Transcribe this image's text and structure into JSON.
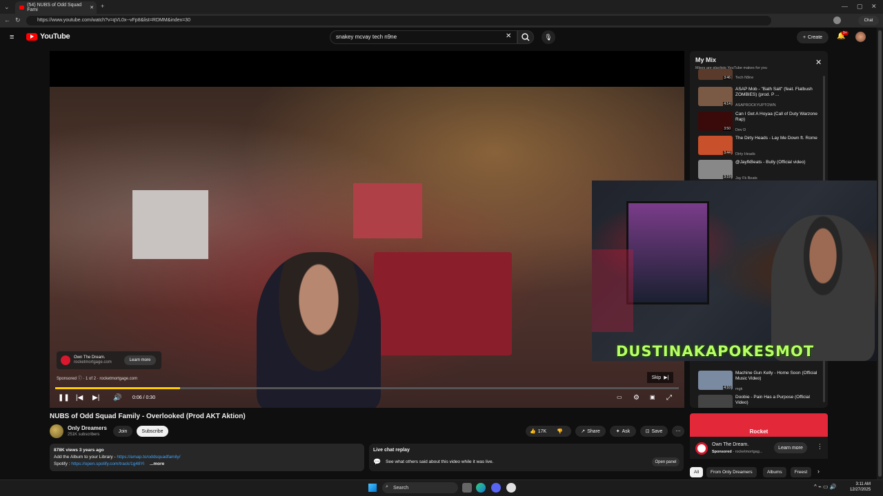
{
  "browser": {
    "tab_title": "(54) NUBS of Odd Squad Fami",
    "url": "https://www.youtube.com/watch?v=qVL0x--vFp8&list=RDMM&index=30",
    "chat_label": "Chat"
  },
  "header": {
    "logo_text": "YouTube",
    "search_value": "snakey mcvay tech n9ne",
    "create_label": "Create",
    "notif_count": "9+"
  },
  "player": {
    "ad_brand": "Own The Dream.",
    "ad_domain": "rocketmortgage.com",
    "ad_learn_more": "Learn more",
    "sponsored": "Sponsored",
    "ad_count": "1 of 2",
    "ad_site": "rocketmortgage.com",
    "skip_label": "Skip",
    "time": "0:06 / 0:30",
    "progress": 0.2
  },
  "video": {
    "title": "NUBS of Odd Squad Family - Overlooked (Prod AKT Aktion)",
    "channel": "Only Dreamers",
    "subscribers": "251K subscribers",
    "join_label": "Join",
    "subscribe_label": "Subscribe",
    "likes": "17K",
    "share_label": "Share",
    "ask_label": "Ask",
    "save_label": "Save"
  },
  "description": {
    "meta": "878K views  3 years ago",
    "line1_prefix": "Add the Album to your Library - ",
    "line1_link": "https://amap.to/oddsquadfamily/",
    "line2_prefix": "Spotify : ",
    "line2_link": "https://open.spotify.com/track/1g48Yi",
    "more": "...more"
  },
  "livechat": {
    "title": "Live chat replay",
    "text": "See what others said about this video while it was live.",
    "open_label": "Open panel"
  },
  "mix": {
    "title": "My Mix",
    "subtitle": "Mixes are playlists YouTube makes for you",
    "items": [
      {
        "title": "",
        "artist": "Tech N9ne",
        "duration": "3:46",
        "color": "#5a3a2a"
      },
      {
        "title": "ASAP Mob - \"Bath Salt\" (feat. Flatbush ZOMBIES) (prod. P ...",
        "artist": "ASAPROCKYUPTOWN",
        "duration": "4:14",
        "color": "#7a5a45"
      },
      {
        "title": "Can I Get A Hoyaa (Call of Duty Warzone Rap)",
        "artist": "Dev D",
        "duration": "3:50",
        "color": "#3a0a0a"
      },
      {
        "title": "The Dirty Heads - Lay Me Down ft. Rome",
        "artist": "Dirty Heads",
        "duration": "3:44",
        "color": "#c8502a"
      },
      {
        "title": "@JayfkBeats - Bully (Official video)",
        "artist": "Jay Fk Beats",
        "duration": "3:19",
        "color": "#888888"
      }
    ],
    "lower_items": [
      {
        "title": "Machine Gun Kelly - Home Soon (Official Music Video)",
        "artist": "mgk",
        "duration": "4:10",
        "color": "#7a8aa0"
      },
      {
        "title": "Doobie - Pain Has a Purpose (Official Video)",
        "artist": "",
        "duration": "",
        "color": "#444444"
      }
    ]
  },
  "stream_overlay": {
    "name": "DUSTINAKAPOKESMOT"
  },
  "ad_card": {
    "banner": "Rocket",
    "brand": "Own The Dream.",
    "sponsored": "Sponsored",
    "domain": "rocketmortgag...",
    "learn_more": "Learn more"
  },
  "chips": [
    "All",
    "From Only Dreamers",
    "Albums",
    "Freest"
  ],
  "taskbar": {
    "search_label": "Search",
    "time": "3:11 AM",
    "date": "12/27/2025"
  }
}
